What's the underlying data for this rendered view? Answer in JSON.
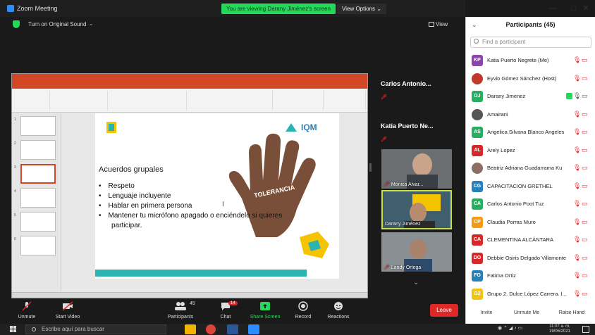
{
  "window": {
    "title": "Zoom Meeting",
    "viewing_banner": "You are viewing Darany Jiménez's screen",
    "view_options": "View Options",
    "controls": [
      "—",
      "□",
      "✕"
    ]
  },
  "meeting_bar": {
    "sound_label": "Turn on Original Sound",
    "view_label": "View"
  },
  "slide": {
    "title": "Acuerdos grupales",
    "bullets": [
      "Respeto",
      "Lenguaje incluyente",
      "Hablar en primera persona",
      "Mantener tu micrófono apagado o enciéndelo si quieres"
    ],
    "bullet_continuation": "participar.",
    "logo_text": "IQM",
    "hand_word": "TOLERANCIA",
    "colors": {
      "band": "#2bb3b1",
      "hand": "#7a4f3a",
      "yellow": "#f5c400",
      "ppt_red": "#d24726"
    }
  },
  "videos": [
    {
      "header": "Carlos Antonio...",
      "has_video": false
    },
    {
      "header": "Katia Puerto Ne...",
      "has_video": false
    },
    {
      "name": "Mónica Alvar...",
      "muted": true,
      "active": false
    },
    {
      "name": "Darany Jiménez",
      "muted": false,
      "active": true
    },
    {
      "name": "Landy Ortega",
      "muted": true,
      "active": false
    }
  ],
  "toolbar": {
    "unmute": "Unmute",
    "start_video": "Start Video",
    "participants": "Participants",
    "participants_count": "45",
    "chat": "Chat",
    "chat_badge": "14",
    "share_screen": "Share Screen",
    "record": "Record",
    "reactions": "Reactions",
    "leave": "Leave"
  },
  "panel": {
    "title": "Participants (45)",
    "search_placeholder": "Find a participant",
    "participants": [
      {
        "initials": "KP",
        "name": "Katia Puerto Negrete (Me)",
        "color": "#8e44ad",
        "photo": false,
        "muted": true,
        "sharing": false
      },
      {
        "initials": "",
        "name": "Eyvio Gómez Sánchez (Host)",
        "color": "#c0392b",
        "photo": true,
        "muted": true,
        "sharing": false
      },
      {
        "initials": "DJ",
        "name": "Darany Jimenez",
        "color": "#27ae60",
        "photo": false,
        "muted": false,
        "sharing": true
      },
      {
        "initials": "",
        "name": "Amairani",
        "color": "#555555",
        "photo": true,
        "muted": true,
        "sharing": false
      },
      {
        "initials": "AS",
        "name": "Angelica Silvana Blanco Angeles",
        "color": "#27ae60",
        "photo": false,
        "muted": true,
        "sharing": false
      },
      {
        "initials": "AL",
        "name": "Arely Lopez",
        "color": "#d62828",
        "photo": false,
        "muted": true,
        "sharing": false
      },
      {
        "initials": "",
        "name": "Beatriz Adriana Guadarrama Ku",
        "color": "#8d6e63",
        "photo": true,
        "muted": true,
        "sharing": false
      },
      {
        "initials": "CG",
        "name": "CAPACITACION GRETHEL",
        "color": "#2980b9",
        "photo": false,
        "muted": true,
        "sharing": false
      },
      {
        "initials": "CA",
        "name": "Carlos Antonio Poot Tuz",
        "color": "#27ae60",
        "photo": false,
        "muted": true,
        "sharing": false
      },
      {
        "initials": "CP",
        "name": "Claudia Porras Muro",
        "color": "#f39c12",
        "photo": false,
        "muted": true,
        "sharing": false
      },
      {
        "initials": "CA",
        "name": "CLEMENTINA ALCÁNTARA",
        "color": "#d62828",
        "photo": false,
        "muted": true,
        "sharing": false
      },
      {
        "initials": "DO",
        "name": "Debbie Osiris Delgado Villamonte",
        "color": "#d62828",
        "photo": false,
        "muted": true,
        "sharing": false
      },
      {
        "initials": "FO",
        "name": "Fatima Ortiz",
        "color": "#2980b9",
        "photo": false,
        "muted": true,
        "sharing": false
      },
      {
        "initials": "G2",
        "name": "Grupo 2. Dulce López Carrera. I...",
        "color": "#f1c40f",
        "photo": false,
        "muted": true,
        "sharing": false
      }
    ],
    "footer": {
      "invite": "Invite",
      "unmute_me": "Unmute Me",
      "raise_hand": "Raise Hand"
    }
  },
  "taskbar": {
    "search_placeholder": "Escribe aquí para buscar",
    "time": "11:07 a. m.",
    "date": "19/06/2021"
  }
}
